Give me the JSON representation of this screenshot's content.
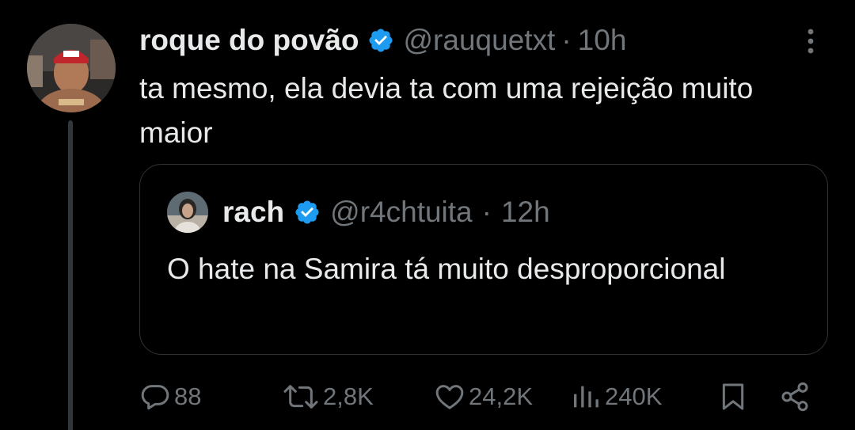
{
  "tweet": {
    "author_name": "roque do povão",
    "author_handle": "@rauquetxt",
    "separator": "·",
    "time": "10h",
    "text": "ta mesmo, ela devia ta com uma rejeição muito maior"
  },
  "quote": {
    "author_name": "rach",
    "author_handle": "@r4chtuita",
    "separator": "·",
    "time": "12h",
    "text": "O hate na Samira tá muito desproporcional"
  },
  "actions": {
    "replies": "88",
    "reposts": "2,8K",
    "likes": "24,2K",
    "views": "240K"
  },
  "colors": {
    "background": "#000000",
    "text": "#e7e9ea",
    "muted": "#71767b",
    "verified": "#1d9bf0",
    "border": "#2f3336"
  },
  "icons": [
    "verified-badge-icon",
    "more-options-icon",
    "reply-icon",
    "repost-icon",
    "like-icon",
    "views-icon",
    "bookmark-icon",
    "share-icon"
  ]
}
